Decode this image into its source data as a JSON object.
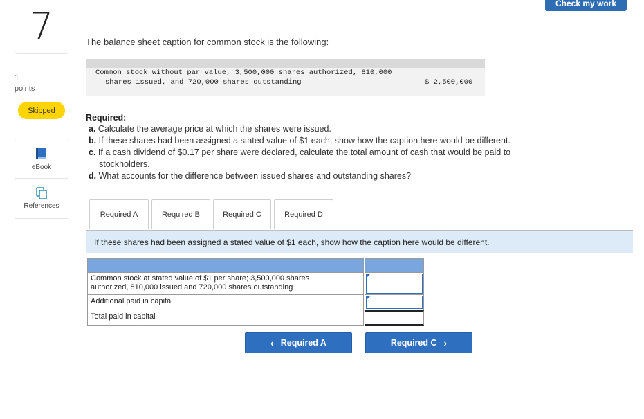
{
  "question": {
    "number": "7",
    "points_value": "1",
    "points_label": "points",
    "status": "Skipped"
  },
  "sidebar": {
    "ebook": {
      "label": "eBook",
      "icon": "book-icon"
    },
    "references": {
      "label": "References",
      "icon": "references-icon"
    }
  },
  "header": {
    "check_button": "Check my work"
  },
  "prompt": {
    "title": "The balance sheet caption for common stock is the following:"
  },
  "caption_box": {
    "line1": "Common stock without par value, 3,500,000 shares authorized, 810,000",
    "line2": "shares issued, and 720,000 shares outstanding",
    "amount": "$ 2,500,000"
  },
  "required": {
    "heading": "Required:",
    "items": [
      {
        "letter": "a.",
        "text": "Calculate the average price at which the shares were issued."
      },
      {
        "letter": "b.",
        "text": "If these shares had been assigned a stated value of $1 each, show how the caption here would be different."
      },
      {
        "letter": "c.",
        "text": "If a cash dividend of $0.17 per share were declared, calculate the total amount of cash that would be paid to"
      },
      {
        "letter": "",
        "text": "stockholders."
      },
      {
        "letter": "d.",
        "text": "What accounts for the difference between issued shares and outstanding shares?"
      }
    ]
  },
  "tabs": [
    {
      "label": "Required A",
      "active": false
    },
    {
      "label": "Required B",
      "active": true
    },
    {
      "label": "Required C",
      "active": false
    },
    {
      "label": "Required D",
      "active": false
    }
  ],
  "active_prompt": "If these shares had been assigned a stated value of $1 each, show how the caption here would be different.",
  "answer_table": {
    "rows": [
      {
        "label_line1": "Common stock at stated value of $1 per share; 3,500,000 shares",
        "label_line2": "authorized, 810,000 issued and 720,000 shares outstanding",
        "value": ""
      },
      {
        "label_line1": "Additional paid in capital",
        "value": ""
      },
      {
        "label_line1": "Total paid in capital",
        "value": ""
      }
    ]
  },
  "navigation": {
    "prev_label": "Required A",
    "next_label": "Required C"
  },
  "colors": {
    "accent": "#2f6fbf",
    "skipped_badge": "#ffd400",
    "table_header": "#7aa6e0",
    "prompt_bar": "#dcebf7"
  }
}
